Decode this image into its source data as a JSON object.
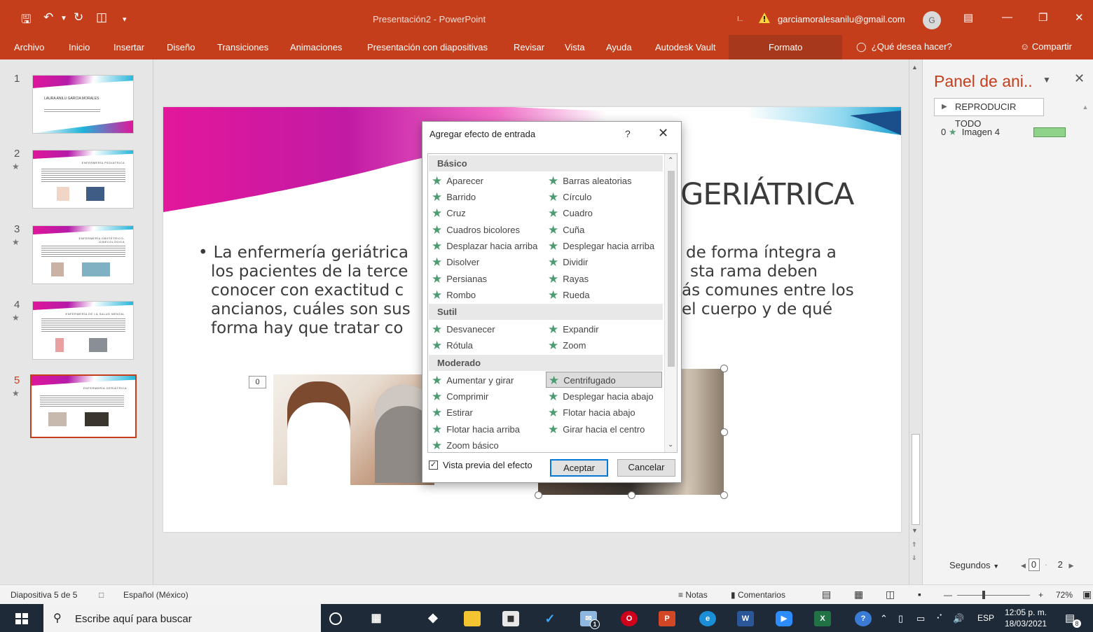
{
  "window": {
    "title": "Presentación2  -  PowerPoint",
    "account_email": "garciamoralesanilu@gmail.com",
    "avatar_initial": "G",
    "truncated_mark": "I..",
    "accent": "#c43e1c"
  },
  "ribbon": {
    "tabs": [
      "Archivo",
      "Inicio",
      "Insertar",
      "Diseño",
      "Transiciones",
      "Animaciones",
      "Presentación con diapositivas",
      "Revisar",
      "Vista",
      "Ayuda",
      "Autodesk Vault"
    ],
    "context_tab": "Formato",
    "tell_me": "¿Qué desea hacer?",
    "share": "Compartir"
  },
  "thumbnails": [
    {
      "num": "1",
      "star": false,
      "active": false,
      "heading": "LAURA ANILU GARCIA MORALES"
    },
    {
      "num": "2",
      "star": true,
      "active": false,
      "heading": "ENFERMERÍA PEDIATRICA"
    },
    {
      "num": "3",
      "star": true,
      "active": false,
      "heading": "ENFERMERÍA OBSTÉTRICO-GINECOLÓGICA"
    },
    {
      "num": "4",
      "star": true,
      "active": false,
      "heading": "ENFERMERÍA DE LA SALUD MENTAL"
    },
    {
      "num": "5",
      "star": true,
      "active": true,
      "heading": "ENFERMERÍA GERIÁTRICA"
    }
  ],
  "slide": {
    "heading_visible": "GERIÁTRICA",
    "bullet_left": [
      "La enfermería geriátrica",
      "los pacientes de la terce",
      "conocer con exactitud c",
      "ancianos, cuáles son sus",
      "forma hay que tratar co"
    ],
    "bullet_right": [
      "de forma íntegra a",
      "sta rama deben",
      "ás comunes entre los",
      "el cuerpo y de qué"
    ],
    "anim_tag": "0"
  },
  "dialog": {
    "title": "Agregar efecto de entrada",
    "help": "?",
    "sections": [
      {
        "name": "Básico",
        "effects": [
          "Aparecer",
          "Barras aleatorias",
          "Barrido",
          "Círculo",
          "Cruz",
          "Cuadro",
          "Cuadros bicolores",
          "Cuña",
          "Desplazar hacia arriba",
          "Desplegar hacia arriba",
          "Disolver",
          "Dividir",
          "Persianas",
          "Rayas",
          "Rombo",
          "Rueda"
        ]
      },
      {
        "name": "Sutil",
        "effects": [
          "Desvanecer",
          "Expandir",
          "Rótula",
          "Zoom"
        ]
      },
      {
        "name": "Moderado",
        "effects": [
          "Aumentar y girar",
          "Centrifugado",
          "Comprimir",
          "Desplegar hacia abajo",
          "Estirar",
          "Flotar hacia abajo",
          "Flotar hacia arriba",
          "Girar hacia el centro",
          "Zoom básico"
        ]
      }
    ],
    "selected_effect": "Centrifugado",
    "preview_label": "Vista previa del efecto",
    "preview_checked": true,
    "ok": "Aceptar",
    "cancel": "Cancelar"
  },
  "animation_pane": {
    "title": "Panel de ani..",
    "play_all": "REPRODUCIR TODO",
    "item_index": "0",
    "item_name": "Imagen 4",
    "seconds_label": "Segundos",
    "scale_start": "0",
    "scale_end": "2"
  },
  "status_bar": {
    "slide_info": "Diapositiva 5 de 5",
    "language": "Español (México)",
    "notes": "Notas",
    "comments": "Comentarios",
    "zoom": "72%"
  },
  "taskbar": {
    "search_placeholder": "Escribe aquí para buscar",
    "lang": "ESP",
    "time": "12:05 p. m.",
    "date": "18/03/2021",
    "mail_badge": "1",
    "notif_badge": "8"
  }
}
